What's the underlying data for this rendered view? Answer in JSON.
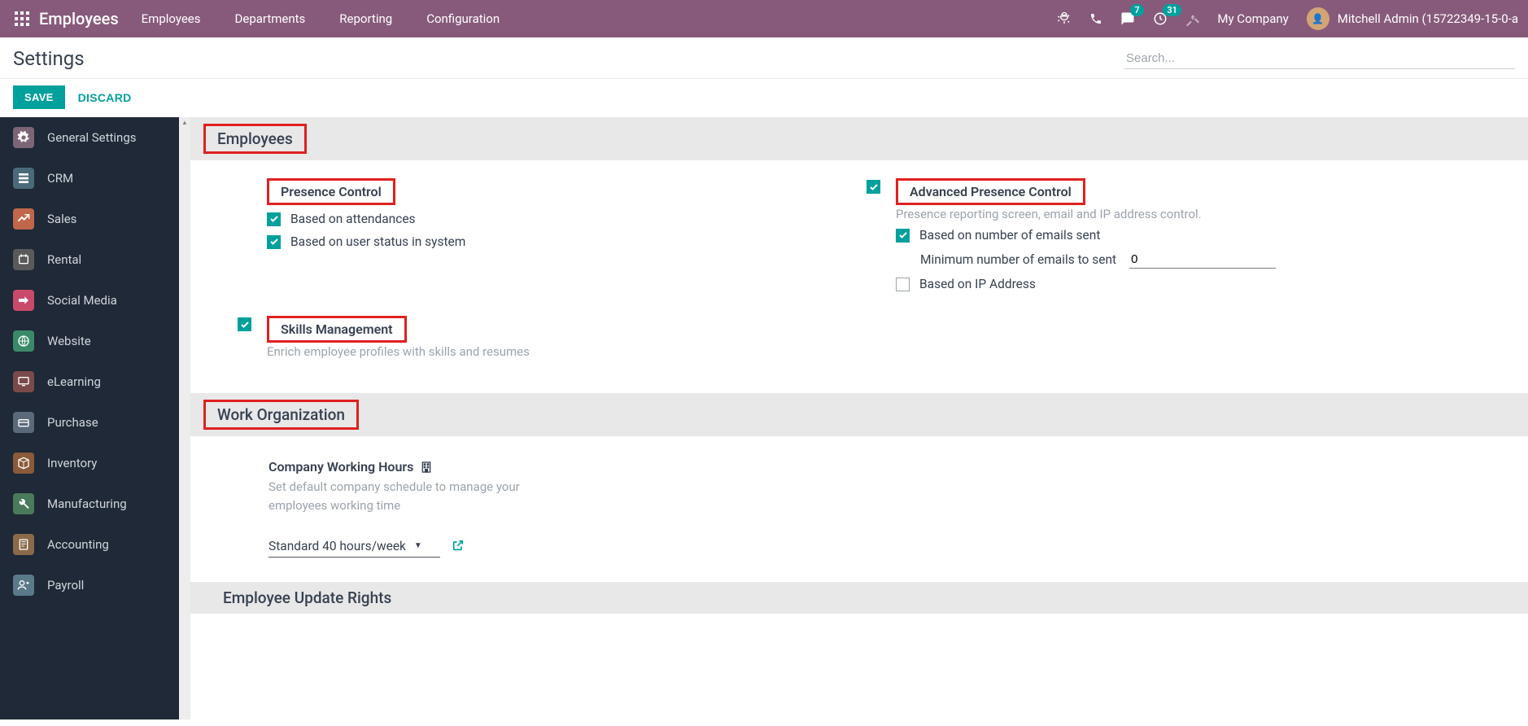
{
  "topnav": {
    "brand": "Employees",
    "menu": [
      "Employees",
      "Departments",
      "Reporting",
      "Configuration"
    ],
    "badges": {
      "chat": "7",
      "activity": "31"
    },
    "company": "My Company",
    "user": "Mitchell Admin (15722349-15-0-a"
  },
  "header": {
    "title": "Settings",
    "search_placeholder": "Search..."
  },
  "actions": {
    "save": "SAVE",
    "discard": "DISCARD"
  },
  "sidebar": [
    {
      "label": "General Settings",
      "color": "#7c6576"
    },
    {
      "label": "CRM",
      "color": "#4a6a7a"
    },
    {
      "label": "Sales",
      "color": "#c0664a"
    },
    {
      "label": "Rental",
      "color": "#5a5a5a"
    },
    {
      "label": "Social Media",
      "color": "#c94a6a"
    },
    {
      "label": "Website",
      "color": "#3a8a6a"
    },
    {
      "label": "eLearning",
      "color": "#7a4a4a"
    },
    {
      "label": "Purchase",
      "color": "#5a6a7a"
    },
    {
      "label": "Inventory",
      "color": "#8a5a3a"
    },
    {
      "label": "Manufacturing",
      "color": "#4a7a5a"
    },
    {
      "label": "Accounting",
      "color": "#8a6a4a"
    },
    {
      "label": "Payroll",
      "color": "#5a7a8a"
    }
  ],
  "sections": {
    "employees": {
      "title": "Employees",
      "presence": {
        "title": "Presence Control",
        "opt_attendance": "Based on attendances",
        "opt_status": "Based on user status in system"
      },
      "advanced": {
        "title": "Advanced Presence Control",
        "desc": "Presence reporting screen, email and IP address control.",
        "opt_emails": "Based on number of emails sent",
        "min_label": "Minimum number of emails to sent",
        "min_value": "0",
        "opt_ip": "Based on IP Address"
      },
      "skills": {
        "title": "Skills Management",
        "desc": "Enrich employee profiles with skills and resumes"
      }
    },
    "work_org": {
      "title": "Work Organization",
      "hours_title": "Company Working Hours",
      "hours_desc": "Set default company schedule to manage your employees working time",
      "hours_value": "Standard 40 hours/week"
    },
    "update_rights": {
      "title": "Employee Update Rights"
    }
  }
}
